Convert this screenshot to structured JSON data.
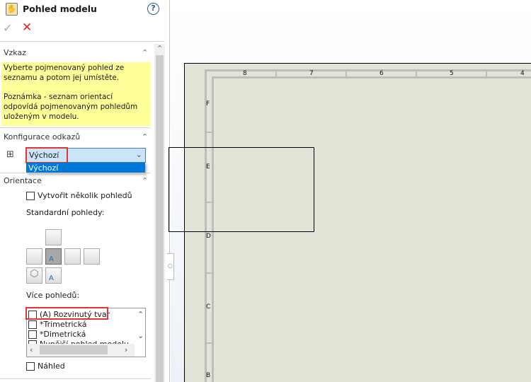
{
  "panel": {
    "title": "Pohled modelu",
    "help_icon": "question-circle-icon",
    "ok_icon": "checkmark-icon",
    "cancel_icon": "red-x-icon",
    "message": {
      "header": "Vzkaz",
      "line1": "Vyberte pojmenovaný pohled ze seznamu a potom jej umístěte.",
      "line2": "Poznámka - seznam orientací odpovídá pojmenovaným pohledům uloženým v modelu."
    },
    "config": {
      "header": "Konfigurace odkazů",
      "selected": "Výchozí",
      "options": [
        "Výchozí"
      ]
    },
    "orientation": {
      "header": "Orientace",
      "multiple_views_label": "Vytvořit několik pohledů",
      "standard_views_label": "Standardní pohledy:",
      "more_views_label": "Více pohledů:",
      "more_views": [
        "(A) Rozvinutý tvar",
        "*Trimetrická",
        "*Dimetrická",
        "Nynější pohled modelu"
      ],
      "preview_label": "Náhled"
    }
  },
  "sheet": {
    "columns": [
      "8",
      "7",
      "6",
      "5",
      "4"
    ],
    "rows": [
      "F",
      "E",
      "D",
      "C",
      "B"
    ]
  }
}
